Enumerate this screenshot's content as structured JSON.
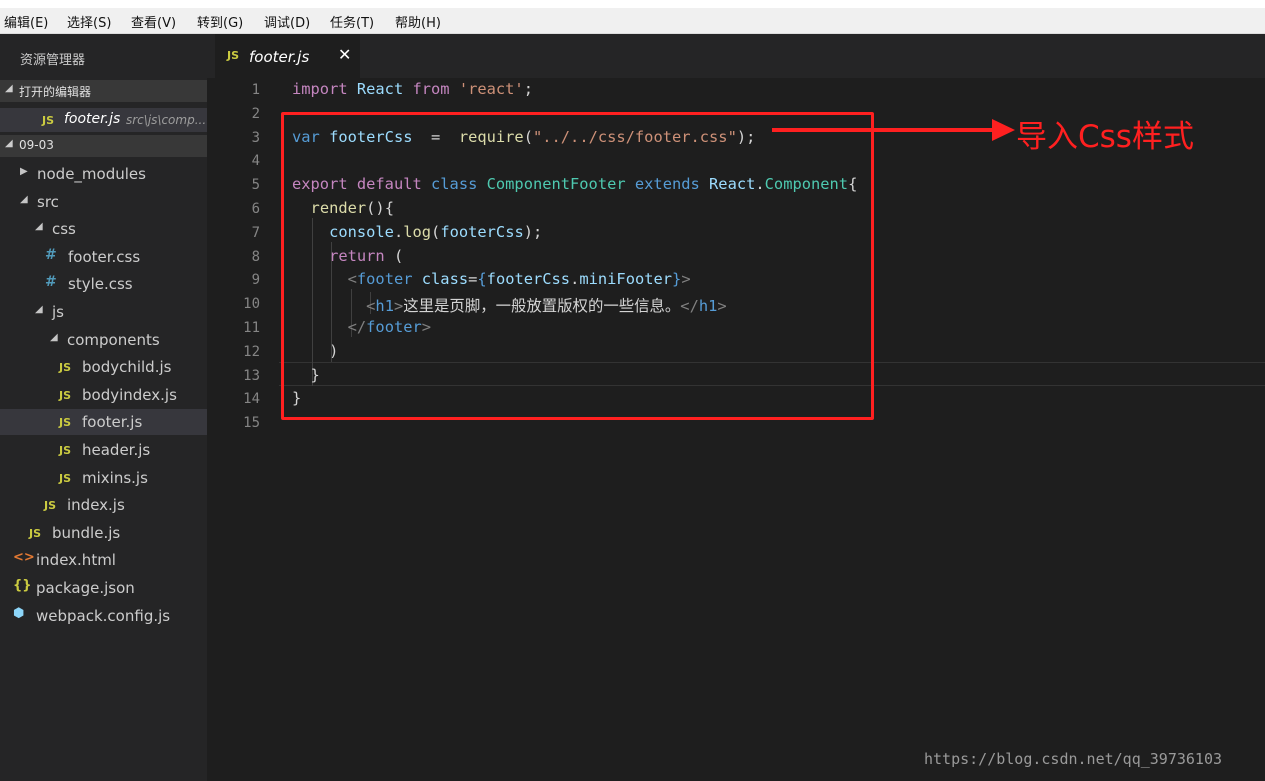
{
  "menubar": {
    "items": [
      "编辑(E)",
      "选择(S)",
      "查看(V)",
      "转到(G)",
      "调试(D)",
      "任务(T)",
      "帮助(H)"
    ]
  },
  "sidebar": {
    "title": "资源管理器",
    "open_editors": {
      "label": "打开的编辑器",
      "file": {
        "name": "footer.js",
        "path": "src\\js\\comp..."
      }
    },
    "folder": {
      "label": "09-03",
      "tree": [
        {
          "name": "node_modules",
          "kind": "folder-closed"
        },
        {
          "name": "src",
          "kind": "folder-open"
        },
        {
          "name": "css",
          "kind": "folder-open"
        },
        {
          "name": "footer.css",
          "kind": "css"
        },
        {
          "name": "style.css",
          "kind": "css"
        },
        {
          "name": "js",
          "kind": "folder-open"
        },
        {
          "name": "components",
          "kind": "folder-open"
        },
        {
          "name": "bodychild.js",
          "kind": "js"
        },
        {
          "name": "bodyindex.js",
          "kind": "js"
        },
        {
          "name": "footer.js",
          "kind": "js",
          "active": true
        },
        {
          "name": "header.js",
          "kind": "js"
        },
        {
          "name": "mixins.js",
          "kind": "js"
        },
        {
          "name": "index.js",
          "kind": "js"
        },
        {
          "name": "bundle.js",
          "kind": "js"
        },
        {
          "name": "index.html",
          "kind": "html"
        },
        {
          "name": "package.json",
          "kind": "json"
        },
        {
          "name": "webpack.config.js",
          "kind": "webpack"
        }
      ]
    },
    "icons": {
      "js": "JS",
      "css": "#",
      "html": "<>",
      "json": "{}",
      "webpack": "⬢"
    }
  },
  "tab": {
    "label": "footer.js",
    "badge": "JS",
    "close": "✕"
  },
  "editor": {
    "line_numbers": [
      "1",
      "2",
      "3",
      "4",
      "5",
      "6",
      "7",
      "8",
      "9",
      "10",
      "11",
      "12",
      "13",
      "14",
      "15"
    ],
    "lines": [
      [
        [
          "import ",
          "kc"
        ],
        [
          "React ",
          "v"
        ],
        [
          "from ",
          "kc"
        ],
        [
          "'react'",
          "s"
        ],
        [
          ";",
          "w"
        ]
      ],
      [],
      [
        [
          "var ",
          "k"
        ],
        [
          "footerCss",
          "v"
        ],
        [
          "  =  ",
          "w"
        ],
        [
          "require",
          "f"
        ],
        [
          "(",
          "w"
        ],
        [
          "\"../../css/footer.css\"",
          "s"
        ],
        [
          ");",
          "w"
        ]
      ],
      [],
      [
        [
          "export ",
          "kc"
        ],
        [
          "default ",
          "kc"
        ],
        [
          "class ",
          "k"
        ],
        [
          "ComponentFooter ",
          "t"
        ],
        [
          "extends ",
          "k"
        ],
        [
          "React",
          "v"
        ],
        [
          ".",
          "w"
        ],
        [
          "Component",
          "t"
        ],
        [
          "{",
          "w"
        ]
      ],
      [
        [
          "  ",
          "w"
        ],
        [
          "render",
          "f"
        ],
        [
          "(){",
          "w"
        ]
      ],
      [
        [
          "    ",
          "w"
        ],
        [
          "console",
          "v"
        ],
        [
          ".",
          "w"
        ],
        [
          "log",
          "f"
        ],
        [
          "(",
          "w"
        ],
        [
          "footerCss",
          "v"
        ],
        [
          ");",
          "w"
        ]
      ],
      [
        [
          "    ",
          "w"
        ],
        [
          "return ",
          "kc"
        ],
        [
          "(",
          "w"
        ]
      ],
      [
        [
          "      ",
          "w"
        ],
        [
          "<",
          "g"
        ],
        [
          "footer ",
          "k"
        ],
        [
          "class",
          "v"
        ],
        [
          "=",
          "w"
        ],
        [
          "{",
          "k"
        ],
        [
          "footerCss",
          "v"
        ],
        [
          ".",
          "w"
        ],
        [
          "miniFooter",
          "v"
        ],
        [
          "}",
          "k"
        ],
        [
          ">",
          "g"
        ]
      ],
      [
        [
          "        ",
          "w"
        ],
        [
          "<",
          "g"
        ],
        [
          "h1",
          "k"
        ],
        [
          ">",
          "g"
        ],
        [
          "这里是页脚，一般放置版权的一些信息。",
          "w"
        ],
        [
          "</",
          "g"
        ],
        [
          "h1",
          "k"
        ],
        [
          ">",
          "g"
        ]
      ],
      [
        [
          "      ",
          "w"
        ],
        [
          "</",
          "g"
        ],
        [
          "footer",
          "k"
        ],
        [
          ">",
          "g"
        ]
      ],
      [
        [
          "    ",
          "w"
        ],
        [
          ")",
          "w"
        ]
      ],
      [
        [
          "  ",
          "w"
        ],
        [
          "}",
          "w"
        ]
      ],
      [
        [
          "}",
          "w"
        ]
      ],
      []
    ]
  },
  "annotation": {
    "label": "导入Css样式",
    "color": "#ff2020"
  },
  "watermark": "https://blog.csdn.net/qq_39736103"
}
